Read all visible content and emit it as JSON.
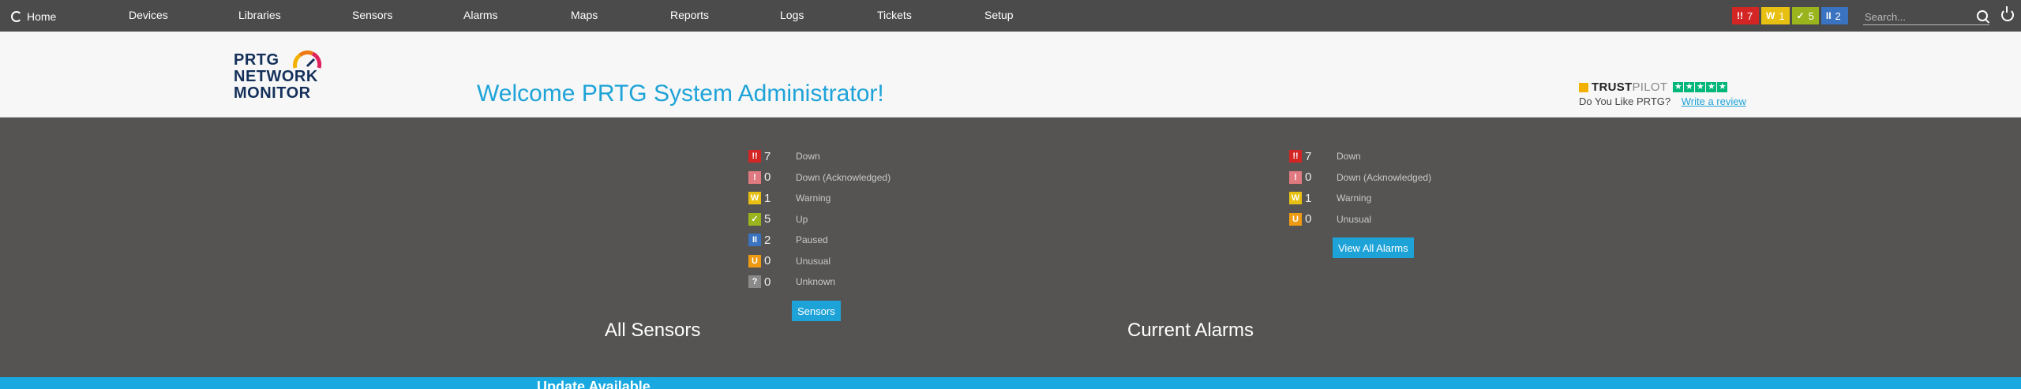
{
  "nav": {
    "home": "Home",
    "items": [
      "Devices",
      "Libraries",
      "Sensors",
      "Alarms",
      "Maps",
      "Reports",
      "Logs",
      "Tickets",
      "Setup"
    ],
    "badges": [
      {
        "glyph": "!!",
        "count": "7",
        "color": "#d42525",
        "icon": "down-icon"
      },
      {
        "glyph": "W",
        "count": "1",
        "color": "#e8c012",
        "icon": "warning-icon"
      },
      {
        "glyph": "✓",
        "count": "5",
        "color": "#9ab41d",
        "icon": "up-icon"
      },
      {
        "glyph": "II",
        "count": "2",
        "color": "#3a73c0",
        "icon": "paused-icon"
      }
    ],
    "search_placeholder": "Search..."
  },
  "header": {
    "logo": "PRTG NETWORK MONITOR",
    "logo_lines": [
      "PRTG",
      "NETWORK",
      "MONITOR"
    ],
    "welcome": "Welcome PRTG System Administrator!",
    "trustpilot": {
      "brand_bold": "TRUST",
      "brand_light": "PILOT",
      "question": "Do You Like PRTG?",
      "link": "Write a review"
    }
  },
  "sensors": {
    "title": "All Sensors",
    "button": "Sensors",
    "rows": [
      {
        "glyph": "!!",
        "count": "7",
        "label": "Down",
        "color": "#d42525",
        "icon": "down-icon"
      },
      {
        "glyph": "!",
        "count": "0",
        "label": "Down (Acknowledged)",
        "color": "#e07a80",
        "icon": "down-acknowledged-icon"
      },
      {
        "glyph": "W",
        "count": "1",
        "label": "Warning",
        "color": "#e8c012",
        "icon": "warning-icon"
      },
      {
        "glyph": "✓",
        "count": "5",
        "label": "Up",
        "color": "#9ab41d",
        "icon": "up-icon"
      },
      {
        "glyph": "II",
        "count": "2",
        "label": "Paused",
        "color": "#3a73c0",
        "icon": "paused-icon"
      },
      {
        "glyph": "U",
        "count": "0",
        "label": "Unusual",
        "color": "#ee9a12",
        "icon": "unusual-icon"
      },
      {
        "glyph": "?",
        "count": "0",
        "label": "Unknown",
        "color": "#8a8a8a",
        "icon": "unknown-icon"
      }
    ]
  },
  "alarms": {
    "title": "Current Alarms",
    "button": "View All Alarms",
    "rows": [
      {
        "glyph": "!!",
        "count": "7",
        "label": "Down",
        "color": "#d42525",
        "icon": "down-icon"
      },
      {
        "glyph": "!",
        "count": "0",
        "label": "Down (Acknowledged)",
        "color": "#e07a80",
        "icon": "down-acknowledged-icon"
      },
      {
        "glyph": "W",
        "count": "1",
        "label": "Warning",
        "color": "#e8c012",
        "icon": "warning-icon"
      },
      {
        "glyph": "U",
        "count": "0",
        "label": "Unusual",
        "color": "#ee9a12",
        "icon": "unusual-icon"
      }
    ]
  },
  "banner": {
    "text": "Update Available"
  }
}
